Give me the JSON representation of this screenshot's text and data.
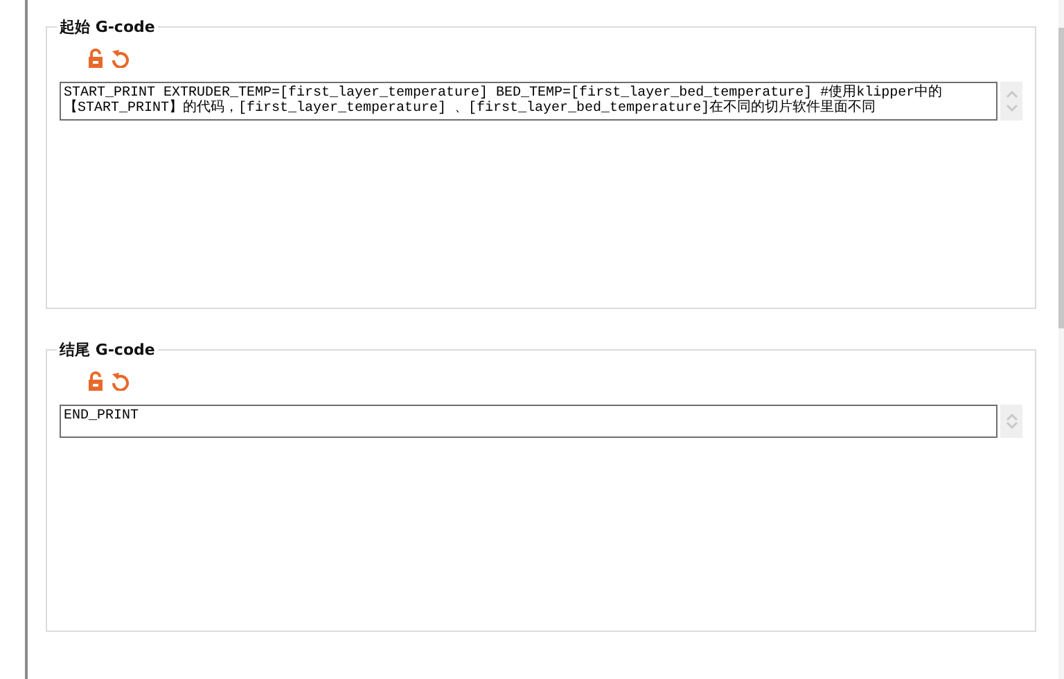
{
  "sections": [
    {
      "title": "起始 G-code",
      "lines": [
        "START_PRINT EXTRUDER_TEMP=[first_layer_temperature] BED_TEMP=[first_layer_bed_temperature] #使用klipper中的",
        "【START_PRINT】的代码，[first_layer_temperature] 、[first_layer_bed_temperature]在不同的切片软件里面不同"
      ]
    },
    {
      "title": "结尾 G-code",
      "lines": [
        "END_PRINT"
      ]
    }
  ]
}
